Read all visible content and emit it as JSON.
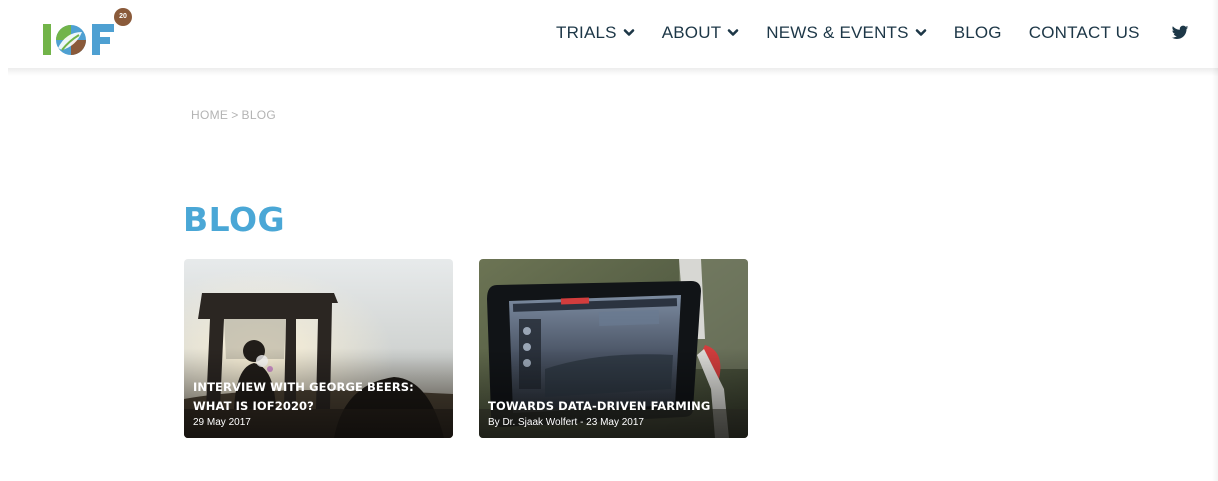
{
  "brand": {
    "logo_letters": "IOF",
    "badge_text": "20",
    "colors": {
      "green": "#72b449",
      "blue": "#4ea0d2",
      "brown": "#8a5a3a"
    }
  },
  "nav": {
    "items": [
      {
        "label": "TRIALS",
        "dropdown": true
      },
      {
        "label": "ABOUT",
        "dropdown": true
      },
      {
        "label": "NEWS & EVENTS",
        "dropdown": true
      },
      {
        "label": "BLOG",
        "dropdown": false
      },
      {
        "label": "CONTACT US",
        "dropdown": false
      }
    ],
    "social_icon": "twitter-icon",
    "text_color": "#1d3747"
  },
  "breadcrumb": {
    "home": "HOME",
    "separator": ">",
    "current": "BLOG"
  },
  "page": {
    "title": "BLOG",
    "title_color": "#4aa7d6"
  },
  "posts": [
    {
      "title": "INTERVIEW WITH GEORGE BEERS: WHAT IS IOF2020?",
      "meta": "29 May 2017",
      "image": "tractor-silhouette-photo"
    },
    {
      "title": "TOWARDS DATA-DRIVEN FARMING",
      "meta": "By Dr. Sjaak Wolfert - 23 May 2017",
      "image": "tablet-on-tractor-photo"
    }
  ]
}
